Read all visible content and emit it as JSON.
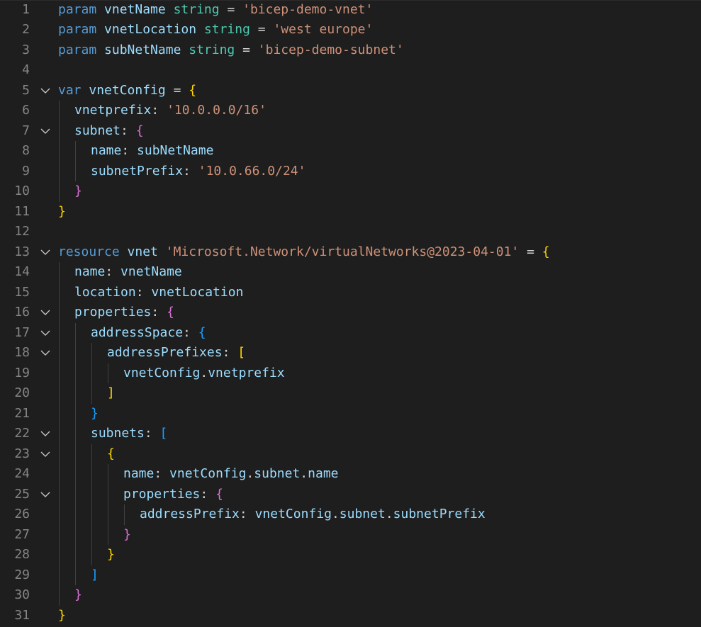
{
  "editor": {
    "language": "bicep",
    "colors": {
      "background": "#1e1e1e",
      "line_number": "#858585",
      "keyword": "#569cd6",
      "identifier": "#9cdcfe",
      "type": "#4ec9b0",
      "string": "#ce9178",
      "operator": "#d4d4d4",
      "bracket_level_1": "#ffd700",
      "bracket_level_2": "#da70d6",
      "bracket_level_3": "#179fff",
      "indent_guide": "#404040",
      "fold_chevron": "#c5c5c5"
    },
    "lines": [
      {
        "num": "1",
        "indent": 0,
        "fold": false,
        "tokens": [
          {
            "t": "param",
            "c": "kw"
          },
          {
            "t": " ",
            "c": "plain"
          },
          {
            "t": "vnetName",
            "c": "var"
          },
          {
            "t": " ",
            "c": "plain"
          },
          {
            "t": "string",
            "c": "type"
          },
          {
            "t": " = ",
            "c": "op"
          },
          {
            "t": "'bicep-demo-vnet'",
            "c": "str"
          }
        ]
      },
      {
        "num": "2",
        "indent": 0,
        "fold": false,
        "tokens": [
          {
            "t": "param",
            "c": "kw"
          },
          {
            "t": " ",
            "c": "plain"
          },
          {
            "t": "vnetLocation",
            "c": "var"
          },
          {
            "t": " ",
            "c": "plain"
          },
          {
            "t": "string",
            "c": "type"
          },
          {
            "t": " = ",
            "c": "op"
          },
          {
            "t": "'west europe'",
            "c": "str"
          }
        ]
      },
      {
        "num": "3",
        "indent": 0,
        "fold": false,
        "tokens": [
          {
            "t": "param",
            "c": "kw"
          },
          {
            "t": " ",
            "c": "plain"
          },
          {
            "t": "subNetName",
            "c": "var"
          },
          {
            "t": " ",
            "c": "plain"
          },
          {
            "t": "string",
            "c": "type"
          },
          {
            "t": " = ",
            "c": "op"
          },
          {
            "t": "'bicep-demo-subnet'",
            "c": "str"
          }
        ]
      },
      {
        "num": "4",
        "indent": 0,
        "fold": false,
        "tokens": []
      },
      {
        "num": "5",
        "indent": 0,
        "fold": true,
        "tokens": [
          {
            "t": "var",
            "c": "kw"
          },
          {
            "t": " ",
            "c": "plain"
          },
          {
            "t": "vnetConfig",
            "c": "var"
          },
          {
            "t": " = ",
            "c": "op"
          },
          {
            "t": "{",
            "c": "b1"
          }
        ]
      },
      {
        "num": "6",
        "indent": 1,
        "fold": false,
        "tokens": [
          {
            "t": "vnetprefix",
            "c": "var"
          },
          {
            "t": ": ",
            "c": "op"
          },
          {
            "t": "'10.0.0.0/16'",
            "c": "str"
          }
        ]
      },
      {
        "num": "7",
        "indent": 1,
        "fold": true,
        "tokens": [
          {
            "t": "subnet",
            "c": "var"
          },
          {
            "t": ": ",
            "c": "op"
          },
          {
            "t": "{",
            "c": "b2"
          }
        ]
      },
      {
        "num": "8",
        "indent": 2,
        "fold": false,
        "tokens": [
          {
            "t": "name",
            "c": "var"
          },
          {
            "t": ": ",
            "c": "op"
          },
          {
            "t": "subNetName",
            "c": "var"
          }
        ]
      },
      {
        "num": "9",
        "indent": 2,
        "fold": false,
        "tokens": [
          {
            "t": "subnetPrefix",
            "c": "var"
          },
          {
            "t": ": ",
            "c": "op"
          },
          {
            "t": "'10.0.66.0/24'",
            "c": "str"
          }
        ]
      },
      {
        "num": "10",
        "indent": 1,
        "fold": false,
        "tokens": [
          {
            "t": "}",
            "c": "b2"
          }
        ]
      },
      {
        "num": "11",
        "indent": 0,
        "fold": false,
        "tokens": [
          {
            "t": "}",
            "c": "b1"
          }
        ]
      },
      {
        "num": "12",
        "indent": 0,
        "fold": false,
        "tokens": []
      },
      {
        "num": "13",
        "indent": 0,
        "fold": true,
        "tokens": [
          {
            "t": "resource",
            "c": "kw"
          },
          {
            "t": " ",
            "c": "plain"
          },
          {
            "t": "vnet",
            "c": "var"
          },
          {
            "t": " ",
            "c": "plain"
          },
          {
            "t": "'Microsoft.Network/virtualNetworks@2023-04-01'",
            "c": "str"
          },
          {
            "t": " = ",
            "c": "op"
          },
          {
            "t": "{",
            "c": "b1"
          }
        ]
      },
      {
        "num": "14",
        "indent": 1,
        "fold": false,
        "tokens": [
          {
            "t": "name",
            "c": "var"
          },
          {
            "t": ": ",
            "c": "op"
          },
          {
            "t": "vnetName",
            "c": "var"
          }
        ]
      },
      {
        "num": "15",
        "indent": 1,
        "fold": false,
        "tokens": [
          {
            "t": "location",
            "c": "var"
          },
          {
            "t": ": ",
            "c": "op"
          },
          {
            "t": "vnetLocation",
            "c": "var"
          }
        ]
      },
      {
        "num": "16",
        "indent": 1,
        "fold": true,
        "tokens": [
          {
            "t": "properties",
            "c": "var"
          },
          {
            "t": ": ",
            "c": "op"
          },
          {
            "t": "{",
            "c": "b2"
          }
        ]
      },
      {
        "num": "17",
        "indent": 2,
        "fold": true,
        "tokens": [
          {
            "t": "addressSpace",
            "c": "var"
          },
          {
            "t": ": ",
            "c": "op"
          },
          {
            "t": "{",
            "c": "b3"
          }
        ]
      },
      {
        "num": "18",
        "indent": 3,
        "fold": true,
        "tokens": [
          {
            "t": "addressPrefixes",
            "c": "var"
          },
          {
            "t": ": ",
            "c": "op"
          },
          {
            "t": "[",
            "c": "b1"
          }
        ]
      },
      {
        "num": "19",
        "indent": 4,
        "fold": false,
        "tokens": [
          {
            "t": "vnetConfig",
            "c": "var"
          },
          {
            "t": ".",
            "c": "op"
          },
          {
            "t": "vnetprefix",
            "c": "var"
          }
        ]
      },
      {
        "num": "20",
        "indent": 3,
        "fold": false,
        "tokens": [
          {
            "t": "]",
            "c": "b1"
          }
        ]
      },
      {
        "num": "21",
        "indent": 2,
        "fold": false,
        "tokens": [
          {
            "t": "}",
            "c": "b3"
          }
        ]
      },
      {
        "num": "22",
        "indent": 2,
        "fold": true,
        "tokens": [
          {
            "t": "subnets",
            "c": "var"
          },
          {
            "t": ": ",
            "c": "op"
          },
          {
            "t": "[",
            "c": "b3"
          }
        ]
      },
      {
        "num": "23",
        "indent": 3,
        "fold": true,
        "tokens": [
          {
            "t": "{",
            "c": "b1"
          }
        ]
      },
      {
        "num": "24",
        "indent": 4,
        "fold": false,
        "tokens": [
          {
            "t": "name",
            "c": "var"
          },
          {
            "t": ": ",
            "c": "op"
          },
          {
            "t": "vnetConfig",
            "c": "var"
          },
          {
            "t": ".",
            "c": "op"
          },
          {
            "t": "subnet",
            "c": "var"
          },
          {
            "t": ".",
            "c": "op"
          },
          {
            "t": "name",
            "c": "var"
          }
        ]
      },
      {
        "num": "25",
        "indent": 4,
        "fold": true,
        "tokens": [
          {
            "t": "properties",
            "c": "var"
          },
          {
            "t": ": ",
            "c": "op"
          },
          {
            "t": "{",
            "c": "b2"
          }
        ]
      },
      {
        "num": "26",
        "indent": 5,
        "fold": false,
        "tokens": [
          {
            "t": "addressPrefix",
            "c": "var"
          },
          {
            "t": ": ",
            "c": "op"
          },
          {
            "t": "vnetConfig",
            "c": "var"
          },
          {
            "t": ".",
            "c": "op"
          },
          {
            "t": "subnet",
            "c": "var"
          },
          {
            "t": ".",
            "c": "op"
          },
          {
            "t": "subnetPrefix",
            "c": "var"
          }
        ]
      },
      {
        "num": "27",
        "indent": 4,
        "fold": false,
        "tokens": [
          {
            "t": "}",
            "c": "b2"
          }
        ]
      },
      {
        "num": "28",
        "indent": 3,
        "fold": false,
        "tokens": [
          {
            "t": "}",
            "c": "b1"
          }
        ]
      },
      {
        "num": "29",
        "indent": 2,
        "fold": false,
        "tokens": [
          {
            "t": "]",
            "c": "b3"
          }
        ]
      },
      {
        "num": "30",
        "indent": 1,
        "fold": false,
        "tokens": [
          {
            "t": "}",
            "c": "b2"
          }
        ]
      },
      {
        "num": "31",
        "indent": 0,
        "fold": false,
        "tokens": [
          {
            "t": "}",
            "c": "b1"
          }
        ]
      }
    ]
  }
}
